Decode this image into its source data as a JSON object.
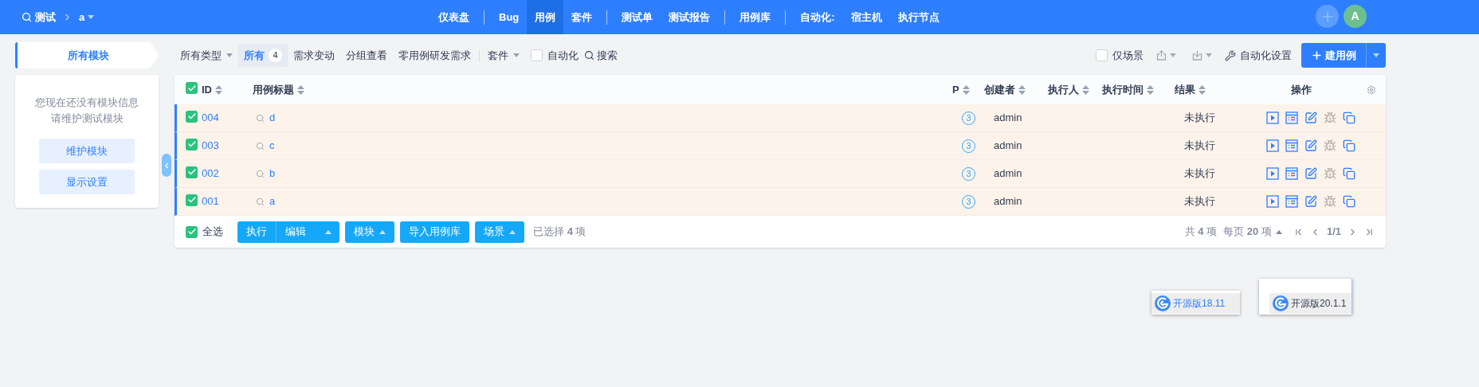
{
  "breadcrumb": {
    "product": "测试",
    "branch": "a"
  },
  "nav_groups": [
    [
      {
        "label": "仪表盘",
        "selected": false
      }
    ],
    [
      {
        "label": "Bug",
        "selected": false
      },
      {
        "label": "用例",
        "selected": true
      },
      {
        "label": "套件",
        "selected": false
      }
    ],
    [
      {
        "label": "测试单",
        "selected": false
      },
      {
        "label": "测试报告",
        "selected": false
      }
    ],
    [
      {
        "label": "用例库",
        "selected": false
      }
    ],
    [
      {
        "label": "自动化:",
        "selected": false
      },
      {
        "label": "宿主机",
        "selected": false
      },
      {
        "label": "执行节点",
        "selected": false
      }
    ]
  ],
  "user_avatar": "A",
  "sidebar": {
    "tab": "所有模块",
    "empty_message": [
      "您现在还没有模块信息",
      "请维护测试模块"
    ],
    "buttons": [
      "维护模块",
      "显示设置"
    ]
  },
  "filters": [
    {
      "kind": "dropdown",
      "label": "所有类型"
    },
    {
      "kind": "tab",
      "label": "所有",
      "count": "4",
      "selected": true
    },
    {
      "kind": "tab",
      "label": "需求变动",
      "selected": false
    },
    {
      "kind": "tab",
      "label": "分组查看",
      "selected": false
    },
    {
      "kind": "tab",
      "label": "零用例研发需求",
      "selected": false
    },
    {
      "kind": "divider"
    },
    {
      "kind": "dropdown",
      "label": "套件"
    },
    {
      "kind": "checkbox",
      "label": "自动化",
      "checked": false
    },
    {
      "kind": "search",
      "label": "搜索"
    }
  ],
  "toolbar_right": {
    "scene_only": {
      "label": "仅场景",
      "checked": false
    },
    "automation_settings": "自动化设置",
    "create_button": "建用例"
  },
  "table": {
    "columns": [
      {
        "label": "ID",
        "sortable": true
      },
      {
        "label": "用例标题",
        "sortable": true
      },
      {
        "label": "P",
        "sortable": true
      },
      {
        "label": "创建者",
        "sortable": true
      },
      {
        "label": "执行人",
        "sortable": true
      },
      {
        "label": "执行时间",
        "sortable": true
      },
      {
        "label": "结果",
        "sortable": true
      },
      {
        "label": "操作",
        "sortable": false
      }
    ],
    "header_checked": true,
    "rows": [
      {
        "id": "004",
        "title": "d",
        "priority": "3",
        "creator": "admin",
        "result": "未执行",
        "checked": true
      },
      {
        "id": "003",
        "title": "c",
        "priority": "3",
        "creator": "admin",
        "result": "未执行",
        "checked": true
      },
      {
        "id": "002",
        "title": "b",
        "priority": "3",
        "creator": "admin",
        "result": "未执行",
        "checked": true
      },
      {
        "id": "001",
        "title": "a",
        "priority": "3",
        "creator": "admin",
        "result": "未执行",
        "checked": true
      }
    ]
  },
  "footer": {
    "select_all": {
      "label": "全选",
      "checked": true
    },
    "actions": [
      {
        "label": "执行",
        "kind": "split",
        "second": "编辑"
      },
      {
        "label": "模块",
        "kind": "menu"
      },
      {
        "label": "导入用例库",
        "kind": "plain"
      },
      {
        "label": "场景",
        "kind": "menu"
      }
    ],
    "selected_text": "已选择 **4** 项",
    "total": "共 **4** 项",
    "per_page": "每页 **20** 项",
    "page": "1/1"
  },
  "version_tags": [
    "开源版18.11",
    "开源版20.1.1"
  ]
}
